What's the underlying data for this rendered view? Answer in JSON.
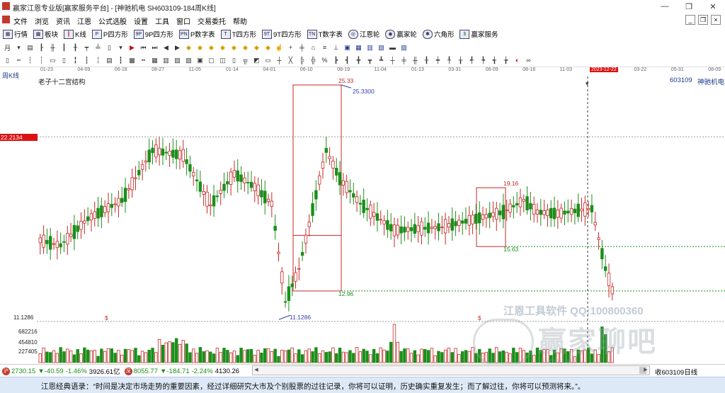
{
  "window": {
    "title": "赢家江恩专业版[赢家服务平台] - [神驰机电  SH603109-184周K线]",
    "controls": [
      "—",
      "❐",
      "✕"
    ]
  },
  "menu": {
    "items": [
      "文件",
      "浏览",
      "资讯",
      "江恩",
      "公式选股",
      "设置",
      "工具",
      "窗口",
      "交易委托",
      "帮助"
    ],
    "right_controls": [
      "_",
      "❐",
      "×"
    ]
  },
  "toolbar": {
    "items": [
      {
        "label": "行情",
        "icon": "grid-icon"
      },
      {
        "label": "板块",
        "icon": "blocks-icon"
      },
      {
        "label": "K线",
        "icon": "kline-icon"
      },
      {
        "label": "P四方形",
        "icon": "p-square-icon"
      },
      {
        "label": "9P四方形",
        "icon": "9p-square-icon"
      },
      {
        "label": "P数字表",
        "icon": "p-table-icon"
      },
      {
        "label": "T四方形",
        "icon": "t-square-icon"
      },
      {
        "label": "9T四方形",
        "icon": "9t-square-icon"
      },
      {
        "label": "T数字表",
        "icon": "t-table-icon"
      },
      {
        "label": "江恩轮",
        "icon": "gann-wheel-icon"
      },
      {
        "label": "赢家轮",
        "icon": "winner-wheel-icon"
      },
      {
        "label": "六角形",
        "icon": "hexagon-icon"
      },
      {
        "label": "赢家服务",
        "icon": "service-icon"
      }
    ],
    "period_label": "月"
  },
  "chart": {
    "period_label": "周K线",
    "study_label": "老子十二宫结构",
    "stock_code": "603109",
    "stock_name": "神驰机电",
    "date_ticks": [
      "01-23",
      "04-09",
      "06-18",
      "08-27",
      "11-05",
      "01-14",
      "04-01",
      "06-10",
      "08-19",
      "11-04",
      "01-13",
      "03-31",
      "06-09",
      "08-18",
      "11-03",
      "2023-12-22",
      "03-22",
      "05-31",
      "08-09"
    ],
    "highlight_date": "2023-12-22",
    "price_marker": "22.2134",
    "high_label": "25.33",
    "high_exact": "25.3300",
    "box_low_label": "12.96",
    "low_label": "11.1286",
    "box2_high": "19.16",
    "box2_low": "15.63",
    "vol_marks": [
      "$",
      "$"
    ],
    "colors": {
      "up": "#c62828",
      "down": "#1a8f1a",
      "box": "#c62828",
      "marker": "#dd1111",
      "accent_blue": "#2f3fb0"
    }
  },
  "chart_data": {
    "type": "candlestick",
    "title": "老子十二宫结构",
    "ylim": [
      11.1286,
      25.33
    ],
    "annotations": [
      "25.33",
      "25.3300",
      "12.96",
      "11.1286",
      "19.16",
      "15.63",
      "22.2134"
    ],
    "volume": {
      "labels": [
        "11.1286",
        "682216",
        "454810",
        "227405"
      ],
      "ticks": [
        227405,
        454810,
        682216
      ]
    }
  },
  "status": {
    "index1": "2730.15",
    "index1_change": "▼-40.59",
    "index1_pct": "-1.46%",
    "index1_amount": "3926.61亿",
    "index2": "8055.77",
    "index2_change": "▼-184.71",
    "index2_pct": "-2.24%",
    "index2_amount": "4130.26",
    "right_label": "收603109日线"
  },
  "watermark": {
    "line1": "江恩工具软件  QQ:100800360",
    "line2": "赢家聊吧",
    "line3": "jiaoba.yd.."
  },
  "footer": {
    "quote": "江恩经典语录：“时间是决定市场走势的重要因素，经过详细研究大市及个别股票的过往记录，你将可以证明，历史确实重复发生；而了解过往，你将可以预测将来。”。"
  }
}
